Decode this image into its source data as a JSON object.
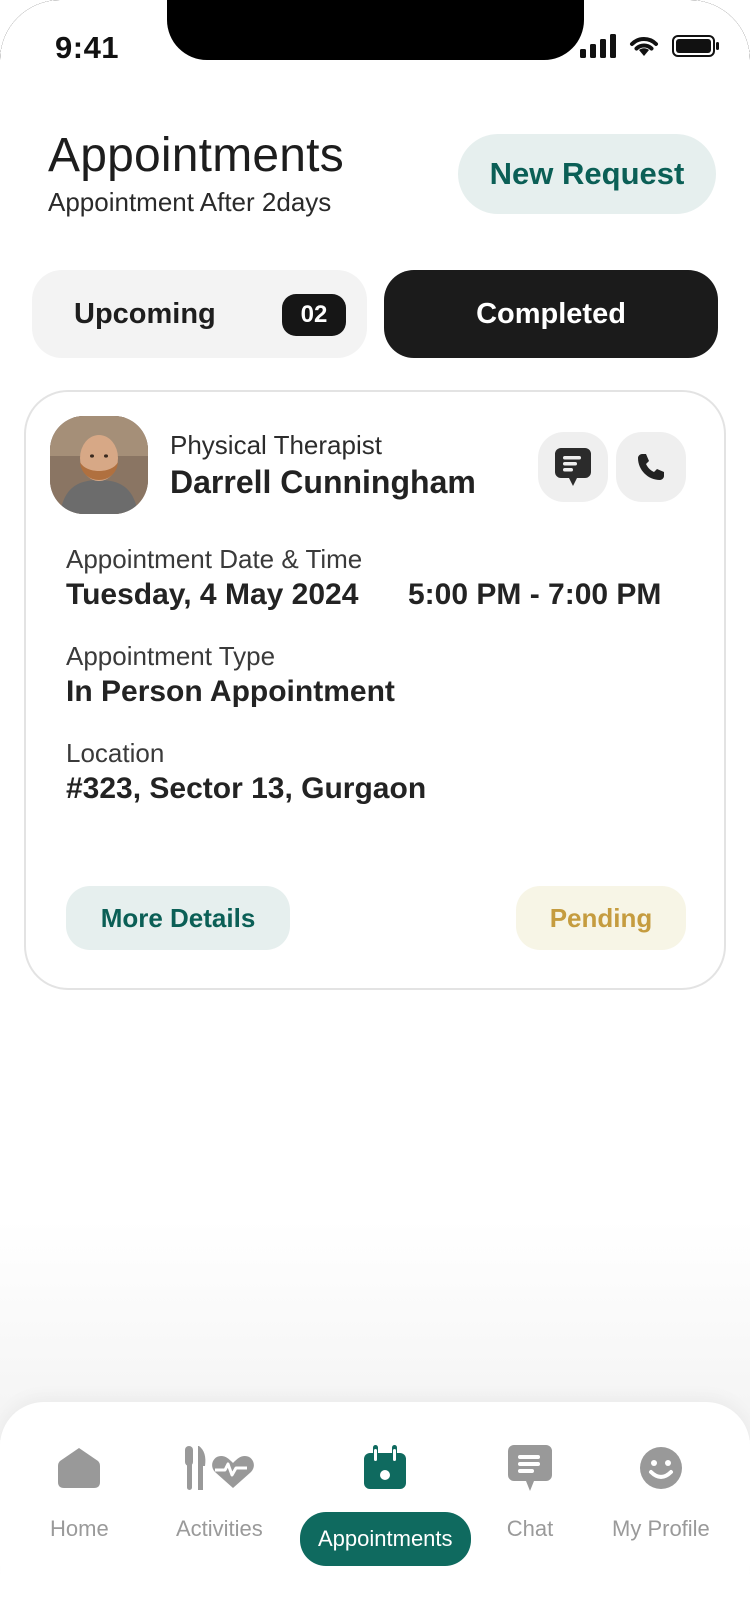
{
  "status_bar": {
    "time": "9:41"
  },
  "header": {
    "title": "Appointments",
    "subtitle": "Appointment After 2days",
    "new_request_label": "New Request"
  },
  "tabs": {
    "upcoming_label": "Upcoming",
    "upcoming_count": "02",
    "completed_label": "Completed"
  },
  "appointment_card": {
    "role": "Physical Therapist",
    "name": "Darrell Cunningham",
    "date_time_label": "Appointment Date & Time",
    "date": "Tuesday, 4 May 2024",
    "time_range": "5:00 PM - 7:00 PM",
    "type_label": "Appointment Type",
    "type_value": "In Person Appointment",
    "location_label": "Location",
    "location_value": "#323, Sector 13, Gurgaon",
    "more_details_label": "More Details",
    "status": "Pending"
  },
  "bottom_nav": {
    "items": [
      {
        "label": "Home",
        "icon": "home-icon"
      },
      {
        "label": "Activities",
        "icon": "activities-icon"
      },
      {
        "label": "Appointments",
        "icon": "calendar-icon",
        "active": true
      },
      {
        "label": "Chat",
        "icon": "chat-icon"
      },
      {
        "label": "My Profile",
        "icon": "profile-icon"
      }
    ]
  },
  "colors": {
    "accent": "#0f6a5f",
    "accent_light": "#e6efee",
    "pending_bg": "#f7f5e6",
    "pending_text": "#c59c3f",
    "dark_tab": "#1b1b1b"
  }
}
